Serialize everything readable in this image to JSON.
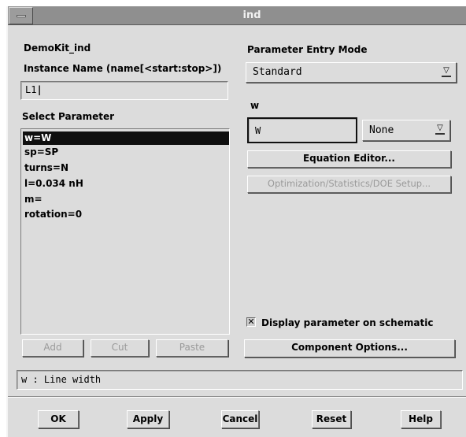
{
  "window": {
    "title": "ind"
  },
  "left": {
    "component_name": "DemoKit_ind",
    "instance_label": "Instance Name  (name[<start:stop>])",
    "instance_value": "L1",
    "select_label": "Select Parameter",
    "parameters": [
      "w=W",
      "sp=SP",
      "turns=N",
      "l=0.034 nH",
      "m=",
      "rotation=0"
    ],
    "selected_index": 0,
    "add_label": "Add",
    "cut_label": "Cut",
    "paste_label": "Paste"
  },
  "right": {
    "entry_mode_label": "Parameter Entry Mode",
    "entry_mode_value": "Standard",
    "param_name": "w",
    "param_value": "W",
    "unit_value": "None",
    "equation_editor_label": "Equation Editor...",
    "optimization_label": "Optimization/Statistics/DOE Setup...",
    "display_checkbox_label": "Display parameter on schematic",
    "display_checked": true,
    "component_options_label": "Component Options..."
  },
  "status": {
    "text": "w : Line width"
  },
  "buttons": {
    "ok": "OK",
    "apply": "Apply",
    "cancel": "Cancel",
    "reset": "Reset",
    "help": "Help"
  },
  "icons": {
    "system_menu": "window-menu-icon",
    "dropdown": "dropdown-arrow-icon",
    "checkbox": "checkbox-x-icon"
  }
}
